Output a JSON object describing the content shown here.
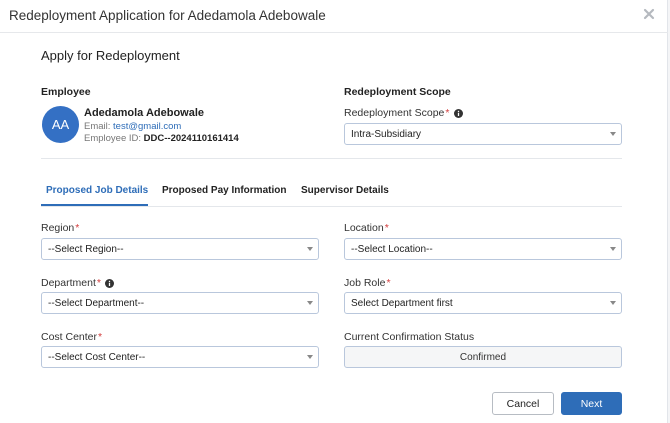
{
  "modal": {
    "title": "Redeployment Application for Adedamola Adebowale",
    "close_icon": "close-icon"
  },
  "section_title": "Apply for Redeployment",
  "employee": {
    "heading": "Employee",
    "avatar_initials": "AA",
    "avatar_color": "#3470c4",
    "name": "Adedamola Adebowale",
    "email_label": "Email:",
    "email": "test@gmail.com",
    "id_label": "Employee ID:",
    "id": "DDC--2024110161414"
  },
  "scope": {
    "heading": "Redeployment Scope",
    "label": "Redeployment Scope",
    "required_mark": "*",
    "value": "Intra-Subsidiary"
  },
  "tabs": [
    {
      "label": "Proposed Job Details",
      "active": true
    },
    {
      "label": "Proposed Pay Information",
      "active": false
    },
    {
      "label": "Supervisor Details",
      "active": false
    }
  ],
  "form": {
    "region": {
      "label": "Region",
      "required_mark": "*",
      "value": "--Select Region--"
    },
    "location": {
      "label": "Location",
      "required_mark": "*",
      "value": "--Select Location--"
    },
    "department": {
      "label": "Department",
      "required_mark": "*",
      "value": "--Select Department--"
    },
    "job_role": {
      "label": "Job Role",
      "required_mark": "*",
      "value": "Select Department first"
    },
    "cost_center": {
      "label": "Cost Center",
      "required_mark": "*",
      "value": "--Select Cost Center--"
    },
    "confirmation": {
      "label": "Current Confirmation Status",
      "value": "Confirmed"
    }
  },
  "actions": {
    "cancel_label": "Cancel",
    "next_label": "Next"
  },
  "colors": {
    "accent": "#2e6db8",
    "required": "#d23b3b"
  }
}
